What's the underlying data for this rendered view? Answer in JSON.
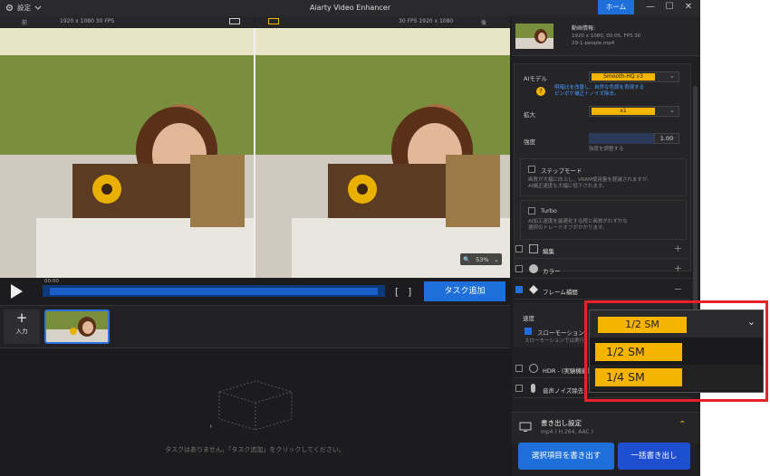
{
  "titlebar": {
    "settings_label": "設定",
    "app_title": "Aiarty Video Enhancer",
    "home_button": "ホーム"
  },
  "preview": {
    "before_label": "前",
    "before_info": "1920 x 1080  30 FPS",
    "after_info": "30 FPS  1920 x 1080",
    "after_label": "後",
    "zoom": "53%"
  },
  "controls": {
    "time": "00:00",
    "bracket_in": "[",
    "bracket_out": "]",
    "task_add_label": "タスク追加"
  },
  "thumbnails": {
    "input_label": "入力",
    "input_plus": "+"
  },
  "queue": {
    "empty_text": "タスクはありません。「タスク追加」をクリックしてください。"
  },
  "panel": {
    "video_info": {
      "heading": "動画情報:",
      "line1": "1920 x 1080, 00:05, FPS 30",
      "line2": "29-1-people.mp4"
    },
    "ai_model_label": "AIモデル",
    "ai_model_value": "Smooth-HQ  v3",
    "ai_model_tip": "明暗比を改善し、自然な色調を表現する",
    "ai_model_tip2": "ピンボケ補正＋ノイズ除去。",
    "upscale_label": "拡大",
    "upscale_value": "x1",
    "strength_label": "強度",
    "strength_value": "1.00",
    "strength_tip": "強度を調整する",
    "step_mode_label": "ステップモード",
    "step_mode_tip1": "画質が大幅に向上し、VRAM使用量を軽減されますが、",
    "step_mode_tip2": "AI補正速度も大幅に低下されます。",
    "turbo_label": "Turbo",
    "turbo_tip1": "AI加工速度を最適化する程と画質がわずかな",
    "turbo_tip2": "選択のトレードオフがかかります。",
    "rows": {
      "edit": "編集",
      "color": "カラー",
      "frame_interp": "フレーム補間",
      "hdr": "HDR - (実験機能)",
      "denoise": "音声ノイズ除去"
    },
    "speed_label": "速度",
    "slowmo_label": "スローモーション",
    "slowmo_tip": "スローモーションでは実行",
    "export_title": "書き出し設定",
    "export_sub": "mp4 ( H.264, AAC )",
    "export_selected": "選択項目を書き出す",
    "export_all": "一括書き出し"
  },
  "dropdown": {
    "current": "1/2 SM",
    "options": [
      "1/2 SM",
      "1/4 SM"
    ]
  },
  "colors": {
    "accent_blue": "#1e6fd9",
    "accent_yellow": "#f5b400",
    "highlight_red": "#e8222a"
  }
}
